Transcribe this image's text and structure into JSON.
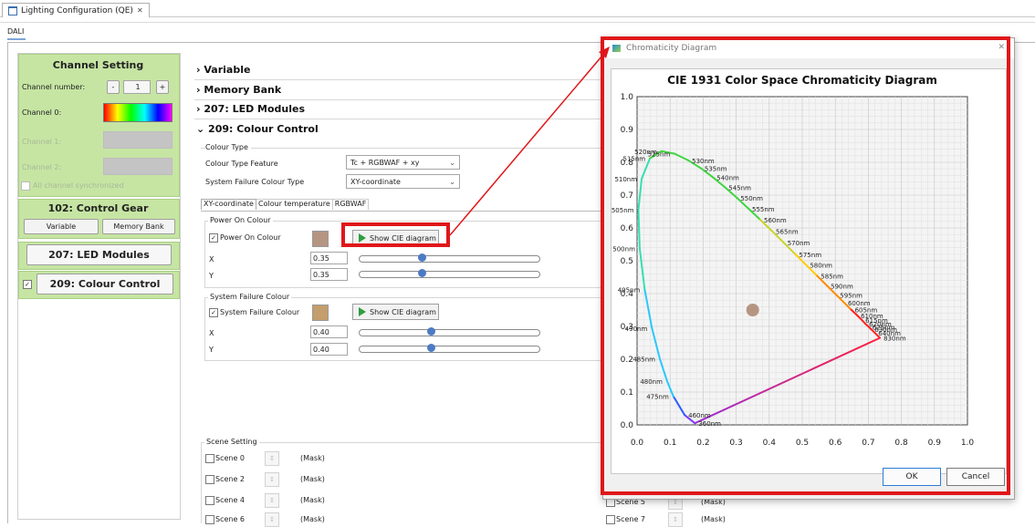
{
  "editor": {
    "tab_title": "Lighting Configuration (QE)",
    "close_symbol": "✕",
    "sub_tab": "DALI"
  },
  "left": {
    "channel_setting_title": "Channel Setting",
    "channel_number_label": "Channel number:",
    "minus_label": "-",
    "channel_number_value": "1",
    "plus_label": "+",
    "channel0_label": "Channel 0:",
    "channel1_label": "Channel 1:",
    "channel2_label": "Channel 2:",
    "all_channel_sync": "All channel synchronized",
    "control_gear_title": "102: Control Gear",
    "variable_btn": "Variable",
    "memory_bank_btn": "Memory Bank",
    "led_modules_title": "207: LED Modules",
    "colour_control_title": "209: Colour Control"
  },
  "middle": {
    "sections": [
      "Variable",
      "Memory Bank",
      "207: LED Modules"
    ],
    "open_section": "209: Colour Control",
    "colour_type_group": "Colour Type",
    "colour_type_feature_label": "Colour Type Feature",
    "colour_type_feature_value": "Tc + RGBWAF + xy",
    "system_failure_type_label": "System Failure Colour Type",
    "system_failure_type_value": "XY-coordinate",
    "subtabs": [
      "XY-coordinate",
      "Colour temperature",
      "RGBWAF"
    ],
    "power_on_group": "Power On Colour",
    "power_on_checkbox": "Power On Colour",
    "power_on_swatch": "#b59582",
    "show_cie_label": "Show CIE diagram",
    "x_label": "X",
    "y_label": "Y",
    "power_on_x": "0.35",
    "power_on_y": "0.35",
    "power_on_x_level": 0.35,
    "power_on_y_level": 0.35,
    "system_failure_group": "System Failure Colour",
    "system_failure_checkbox": "System Failure Colour",
    "system_failure_swatch": "#c49e6c",
    "system_failure_x": "0.40",
    "system_failure_y": "0.40",
    "system_failure_x_level": 0.4,
    "system_failure_y_level": 0.4,
    "scene_setting_group": "Scene Setting",
    "scenes_left": [
      "Scene 0",
      "Scene 2",
      "Scene 4",
      "Scene 6"
    ],
    "scenes_right_visible": [
      "Scene 5",
      "Scene 7"
    ],
    "mask_label": "(Mask)"
  },
  "dialog": {
    "title": "Chromaticity Diagram",
    "close_symbol": "✕",
    "ok_label": "OK",
    "cancel_label": "Cancel"
  },
  "chart_data": {
    "type": "scatter",
    "title": "CIE 1931 Color Space Chromaticity Diagram",
    "xlim": [
      0.0,
      1.0
    ],
    "ylim": [
      0.0,
      1.0
    ],
    "x_ticks": [
      "0.0",
      "0.1",
      "0.2",
      "0.3",
      "0.4",
      "0.5",
      "0.6",
      "0.7",
      "0.8",
      "0.9",
      "1.0"
    ],
    "y_ticks": [
      "0.0",
      "0.1",
      "0.2",
      "0.3",
      "0.4",
      "0.5",
      "0.6",
      "0.7",
      "0.8",
      "0.9",
      "1.0"
    ],
    "grid": true,
    "spectral_locus": [
      {
        "label": "360nm",
        "x": 0.175,
        "y": 0.005
      },
      {
        "label": "460nm",
        "x": 0.144,
        "y": 0.03
      },
      {
        "label": "475nm",
        "x": 0.11,
        "y": 0.087
      },
      {
        "label": "480nm",
        "x": 0.091,
        "y": 0.133
      },
      {
        "label": "485nm",
        "x": 0.069,
        "y": 0.201
      },
      {
        "label": "490nm",
        "x": 0.045,
        "y": 0.295
      },
      {
        "label": "495nm",
        "x": 0.023,
        "y": 0.413
      },
      {
        "label": "500nm",
        "x": 0.008,
        "y": 0.538
      },
      {
        "label": "505nm",
        "x": 0.004,
        "y": 0.655
      },
      {
        "label": "510nm",
        "x": 0.014,
        "y": 0.75
      },
      {
        "label": "515nm",
        "x": 0.039,
        "y": 0.812
      },
      {
        "label": "520nm",
        "x": 0.074,
        "y": 0.834
      },
      {
        "label": "525nm",
        "x": 0.114,
        "y": 0.826
      },
      {
        "label": "530nm",
        "x": 0.155,
        "y": 0.806
      },
      {
        "label": "535nm",
        "x": 0.193,
        "y": 0.782
      },
      {
        "label": "540nm",
        "x": 0.23,
        "y": 0.754
      },
      {
        "label": "545nm",
        "x": 0.266,
        "y": 0.724
      },
      {
        "label": "550nm",
        "x": 0.302,
        "y": 0.692
      },
      {
        "label": "555nm",
        "x": 0.337,
        "y": 0.659
      },
      {
        "label": "560nm",
        "x": 0.373,
        "y": 0.625
      },
      {
        "label": "565nm",
        "x": 0.409,
        "y": 0.59
      },
      {
        "label": "570nm",
        "x": 0.444,
        "y": 0.555
      },
      {
        "label": "575nm",
        "x": 0.479,
        "y": 0.52
      },
      {
        "label": "580nm",
        "x": 0.512,
        "y": 0.487
      },
      {
        "label": "585nm",
        "x": 0.545,
        "y": 0.454
      },
      {
        "label": "590nm",
        "x": 0.575,
        "y": 0.424
      },
      {
        "label": "595nm",
        "x": 0.603,
        "y": 0.396
      },
      {
        "label": "600nm",
        "x": 0.627,
        "y": 0.372
      },
      {
        "label": "605nm",
        "x": 0.648,
        "y": 0.351
      },
      {
        "label": "610nm",
        "x": 0.666,
        "y": 0.334
      },
      {
        "label": "615nm",
        "x": 0.68,
        "y": 0.32
      },
      {
        "label": "620nm",
        "x": 0.691,
        "y": 0.308
      },
      {
        "label": "625nm",
        "x": 0.701,
        "y": 0.299
      },
      {
        "label": "630nm",
        "x": 0.708,
        "y": 0.292
      },
      {
        "label": "640nm",
        "x": 0.719,
        "y": 0.281
      },
      {
        "label": "830nm",
        "x": 0.735,
        "y": 0.265
      }
    ],
    "selected_point": {
      "x": 0.35,
      "y": 0.35,
      "color": "#b59582"
    }
  }
}
